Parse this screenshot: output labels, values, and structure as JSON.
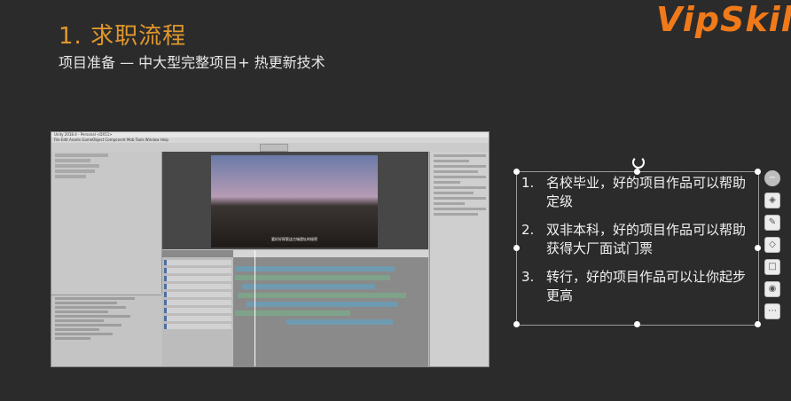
{
  "slide": {
    "title": "1. 求职流程",
    "subtitle": "项目准备 — 中大型完整项目+ 热更新技术",
    "logo_text": "VipSkill"
  },
  "editor_screenshot": {
    "title_bar": "Unity 2018.4 - Personal <DX11>",
    "menu": "File  Edit  Assets  GameObject  Component  Mob Tools  Window  Help",
    "caption": "要好好探索这古城遗址的秘密"
  },
  "list": {
    "items": [
      {
        "num": "1.",
        "text": "名校毕业，好的项目作品可以帮助定级"
      },
      {
        "num": "2.",
        "text": "双非本科，好的项目作品可以帮助获得大厂面试门票"
      },
      {
        "num": "3.",
        "text": "转行，好的项目作品可以让你起步更高"
      }
    ]
  },
  "tools": {
    "items": [
      "minus-icon",
      "layers-icon",
      "pen-icon",
      "fill-icon",
      "crop-icon",
      "pin-icon",
      "more-icon"
    ],
    "labels": [
      "−",
      "◈",
      "✎",
      "◇",
      "□",
      "◉",
      "⋯"
    ]
  },
  "colors": {
    "title": "#e0982c",
    "logo": "#f07a1a",
    "background": "#2b2b2b"
  }
}
